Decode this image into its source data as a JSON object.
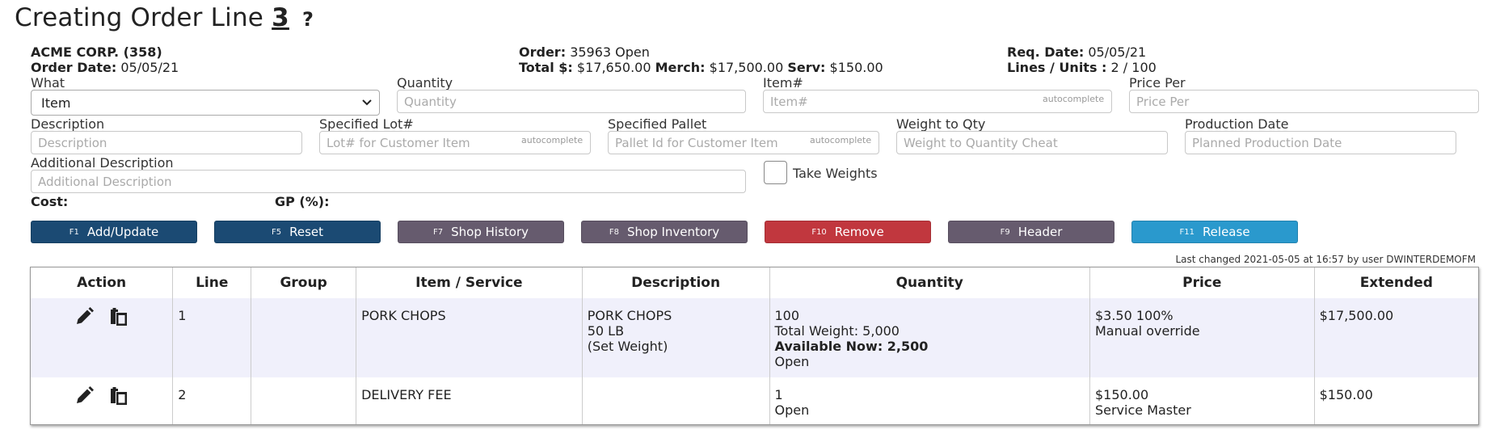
{
  "title": {
    "prefix": "Creating Order Line",
    "line_number": "3",
    "help": "?"
  },
  "customer": {
    "name": "ACME CORP. (358)",
    "order_date_label": "Order Date:",
    "order_date": "05/05/21"
  },
  "order": {
    "label": "Order:",
    "value": "35963 Open",
    "total_label": "Total $:",
    "total": "$17,650.00",
    "merch_label": "Merch:",
    "merch": "$17,500.00",
    "serv_label": "Serv:",
    "serv": "$150.00"
  },
  "req": {
    "label": "Req. Date:",
    "value": "05/05/21",
    "lines_label": "Lines / Units :",
    "lines": "2 / 100"
  },
  "form": {
    "what_label": "What",
    "what_value": "Item",
    "quantity_label": "Quantity",
    "quantity_placeholder": "Quantity",
    "item_label": "Item#",
    "item_placeholder": "Item#",
    "autocomplete": "autocomplete",
    "price_label": "Price Per",
    "price_placeholder": "Price Per",
    "desc_label": "Description",
    "desc_placeholder": "Description",
    "lot_label": "Specified Lot#",
    "lot_placeholder": "Lot# for Customer Item",
    "pallet_label": "Specified Pallet",
    "pallet_placeholder": "Pallet Id for Customer Item",
    "weight_label": "Weight to Qty",
    "weight_placeholder": "Weight to Quantity Cheat",
    "prod_label": "Production Date",
    "prod_placeholder": "Planned Production Date",
    "adddesc_label": "Additional Description",
    "adddesc_placeholder": "Additional Description",
    "take_weights": "Take Weights",
    "cost_label": "Cost:",
    "gp_label": "GP (%):"
  },
  "buttons": [
    {
      "key": "F1",
      "label": "Add/Update",
      "color": "#1b4a73"
    },
    {
      "key": "F5",
      "label": "Reset",
      "color": "#1b4a73"
    },
    {
      "key": "F7",
      "label": "Shop History",
      "color": "#665b6e"
    },
    {
      "key": "F8",
      "label": "Shop Inventory",
      "color": "#665b6e"
    },
    {
      "key": "F10",
      "label": "Remove",
      "color": "#c1373e"
    },
    {
      "key": "F9",
      "label": "Header",
      "color": "#665b6e"
    },
    {
      "key": "F11",
      "label": "Release",
      "color": "#2a99cd"
    }
  ],
  "last_changed": "Last changed 2021-05-05 at 16:57 by user DWINTERDEMOFM",
  "table": {
    "headers": [
      "Action",
      "Line",
      "Group",
      "Item / Service",
      "Description",
      "Quantity",
      "Price",
      "Extended"
    ],
    "rows": [
      {
        "line": "1",
        "group": "",
        "item": "PORK CHOPS",
        "desc": [
          "PORK CHOPS",
          "50 LB",
          "(Set Weight)"
        ],
        "qty": "100",
        "total_weight": "Total Weight: 5,000",
        "available": "Available Now: 2,500",
        "status": "Open",
        "price": "$3.50 100%",
        "price_note": "Manual override",
        "extended": "$17,500.00"
      },
      {
        "line": "2",
        "group": "",
        "item": "DELIVERY FEE",
        "qty": "1",
        "status": "Open",
        "price": "$150.00",
        "price_note": "Service Master",
        "extended": "$150.00"
      }
    ]
  }
}
